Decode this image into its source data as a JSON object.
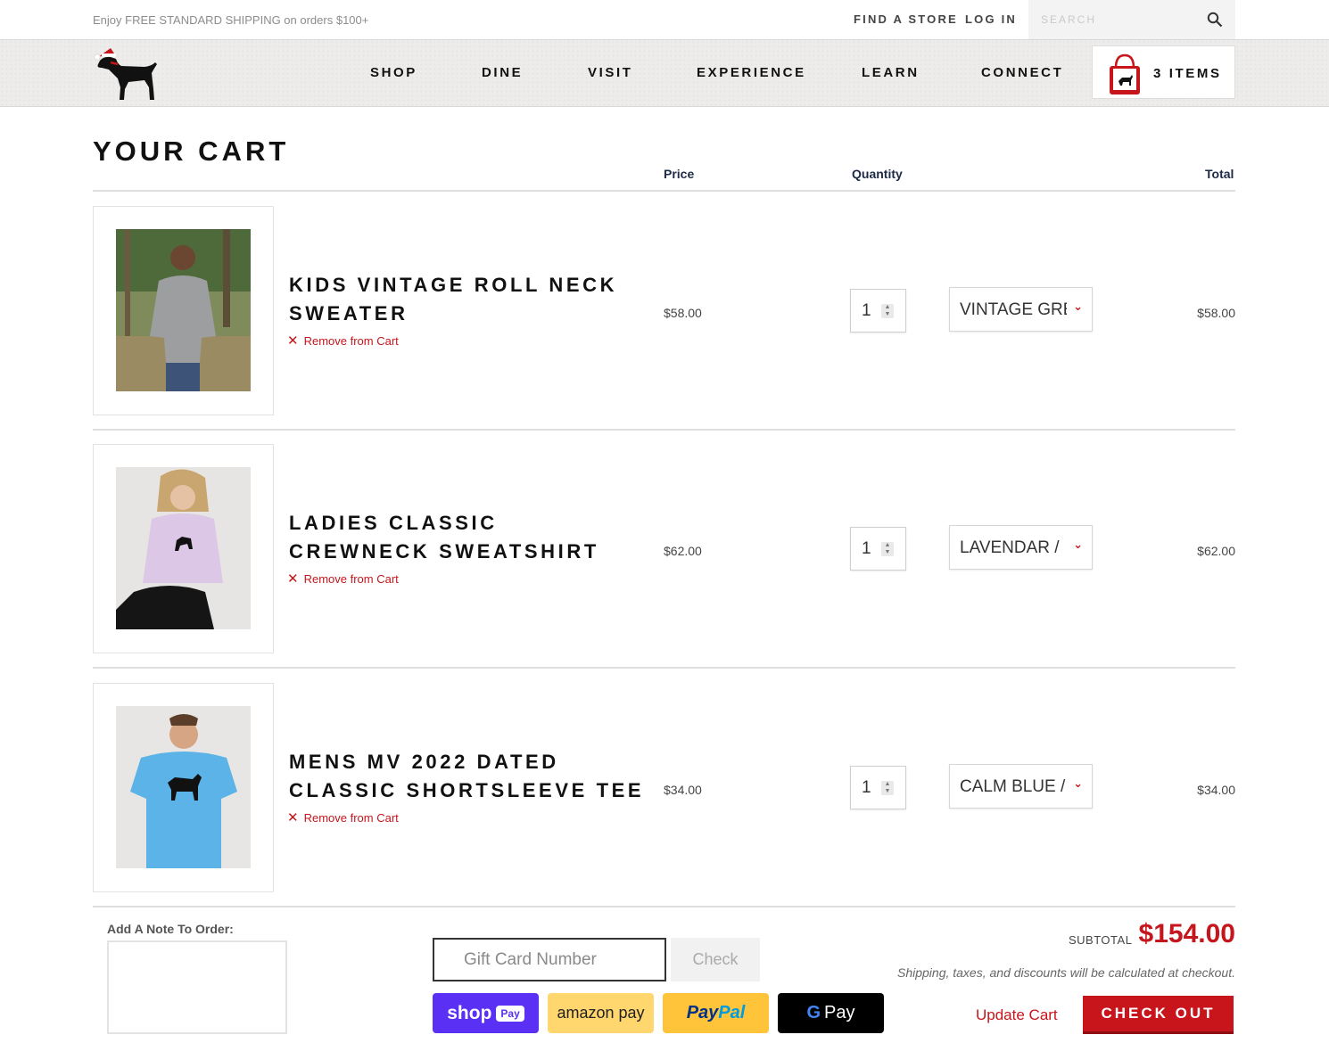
{
  "topbar": {
    "promo": "Enjoy FREE STANDARD SHIPPING on orders $100+",
    "find_store": "FIND A STORE",
    "log_in": "LOG IN",
    "search_placeholder": "SEARCH"
  },
  "nav": {
    "items": [
      "SHOP",
      "DINE",
      "VISIT",
      "EXPERIENCE",
      "LEARN",
      "CONNECT"
    ],
    "cart_label": "3 ITEMS"
  },
  "cart": {
    "title": "YOUR CART",
    "headers": {
      "price": "Price",
      "quantity": "Quantity",
      "total": "Total"
    },
    "remove_label": "Remove from Cart",
    "items": [
      {
        "name": "KIDS VINTAGE ROLL NECK SWEATER",
        "price": "$58.00",
        "quantity": "1",
        "variant": "VINTAGE GRE",
        "total": "$58.00"
      },
      {
        "name": "LADIES CLASSIC CREWNECK SWEATSHIRT",
        "price": "$62.00",
        "quantity": "1",
        "variant": "LAVENDAR /",
        "total": "$62.00"
      },
      {
        "name": "MENS MV 2022 DATED CLASSIC SHORTSLEEVE TEE",
        "price": "$34.00",
        "quantity": "1",
        "variant": "CALM BLUE /",
        "total": "$34.00"
      }
    ]
  },
  "footer": {
    "note_label": "Add A Note To Order:",
    "gift_placeholder": "Gift Card Number",
    "check_label": "Check",
    "pay": {
      "shop": "shop",
      "shop_pill": "Pay",
      "amazon": "amazon pay",
      "paypal_a": "Pay",
      "paypal_b": "Pal",
      "gpay_g": "G",
      "gpay": "Pay"
    },
    "subtotal_label": "SUBTOTAL",
    "subtotal": "$154.00",
    "ship_note": "Shipping, taxes, and discounts will be calculated at checkout.",
    "update_label": "Update Cart",
    "checkout_label": "CHECK OUT"
  },
  "colors": {
    "brand_red": "#c4161c",
    "shop_pay": "#5a31f4",
    "paypal_yellow": "#ffc439",
    "amazon_yellow": "#ffd76e"
  }
}
